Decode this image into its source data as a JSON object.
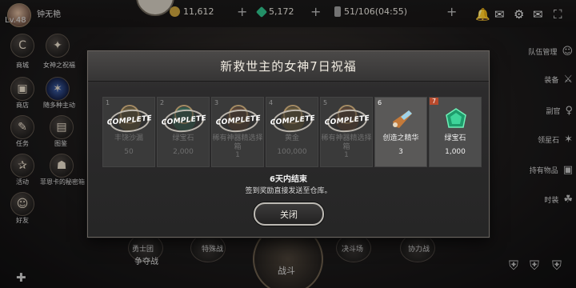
{
  "player": {
    "name": "钟无艳",
    "level": "Lv.48"
  },
  "resources": [
    {
      "value": "11,612",
      "color": "#c9a13c"
    },
    {
      "value": "5,172",
      "color": "#2fbf8a"
    },
    {
      "value": "51/106(04:55)",
      "color": "#9a9a9a"
    }
  ],
  "left_menu": [
    {
      "label": "商城",
      "icon": "shop-icon"
    },
    {
      "label": "女神之祝福",
      "icon": "goddess-blessing-icon"
    },
    {
      "label": "商店",
      "icon": "store-icon"
    },
    {
      "label": "随多种主动",
      "icon": "skill-icon"
    },
    {
      "label": "任务",
      "icon": "quest-icon"
    },
    {
      "label": "图鉴",
      "icon": "codex-icon"
    },
    {
      "label": "活动",
      "icon": "event-icon"
    },
    {
      "label": "菲恩卡的秘密箱",
      "icon": "secret-box-icon"
    },
    {
      "label": "好友",
      "icon": "friends-icon"
    }
  ],
  "right_menu": [
    {
      "label": "队伍管理"
    },
    {
      "label": "装备"
    },
    {
      "label": "副官"
    },
    {
      "label": "领星石"
    },
    {
      "label": "持有物品"
    },
    {
      "label": "时装"
    }
  ],
  "bottom_menu": {
    "left1": "勇士团",
    "left2": "特殊战",
    "center": "战斗",
    "right1": "决斗场",
    "right2": "协力战",
    "war": "争夺战"
  },
  "modal": {
    "title": "新救世主的女神7日祝福",
    "stamp_text": "COMPLETE",
    "slots": [
      {
        "day": "1",
        "name": "丰饶沙漏",
        "count": "50",
        "claimed": true,
        "color": "#c9a13c"
      },
      {
        "day": "2",
        "name": "绿宝石",
        "count": "2,000",
        "claimed": true,
        "color": "#2fbf8a"
      },
      {
        "day": "3",
        "name": "稀有神器精选择箱",
        "count": "1",
        "claimed": true,
        "color": "#b0632f"
      },
      {
        "day": "4",
        "name": "黄金",
        "count": "100,000",
        "claimed": true,
        "color": "#d4a83a"
      },
      {
        "day": "5",
        "name": "稀有神器精选择箱",
        "count": "1",
        "claimed": true,
        "color": "#b0632f"
      },
      {
        "day": "6",
        "name": "创造之精华",
        "count": "3",
        "claimed": false,
        "color": "#c47a3a"
      },
      {
        "day": "7",
        "name": "绿宝石",
        "count": "1,000",
        "claimed": false,
        "color": "#2fbf8a"
      }
    ],
    "end_text": "6天内结束",
    "sub_text": "签到奖励直接发送至仓库。",
    "close_label": "关闭"
  }
}
